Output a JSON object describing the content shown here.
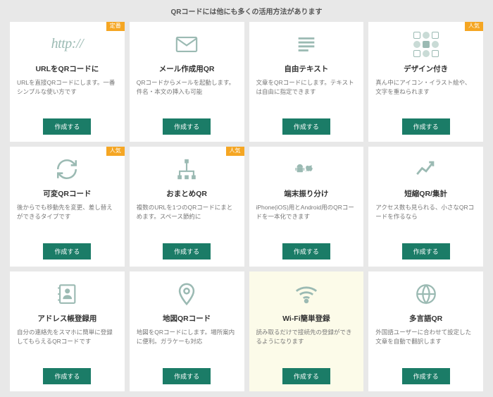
{
  "page_title": "QRコードには他にも多くの活用方法があります",
  "button_label": "作成する",
  "badges": {
    "standard": "定番",
    "popular": "人気"
  },
  "icon_http": "http://",
  "cards": [
    {
      "title": "URLをQRコードに",
      "desc": "URLを直接QRコードにします。一番シンプルな使い方です",
      "badge": "standard"
    },
    {
      "title": "メール作成用QR",
      "desc": "QRコードからメールを起動します。件名・本文の挿入も可能"
    },
    {
      "title": "自由テキスト",
      "desc": "文章をQRコードにします。テキストは自由に指定できます"
    },
    {
      "title": "デザイン付き",
      "desc": "真ん中にアイコン・イラスト絵や、文字を重ねられます",
      "badge": "popular"
    },
    {
      "title": "可変QRコード",
      "desc": "後からでも移動先を変更、差し替えができるタイプです",
      "badge": "popular"
    },
    {
      "title": "おまとめQR",
      "desc": "複数のURLを1つのQRコードにまとめます。スペース節約に",
      "badge": "popular"
    },
    {
      "title": "端末振り分け",
      "desc": "iPhone(iOS)用とAndroid用のQRコードを一本化できます"
    },
    {
      "title": "短縮QR/集計",
      "desc": "アクセス数も見られる、小さなQRコードを作るなら"
    },
    {
      "title": "アドレス帳登録用",
      "desc": "自分の連絡先をスマホに簡単に登録してもらえるQRコードです"
    },
    {
      "title": "地図QRコード",
      "desc": "地図をQRコードにします。場所案内に便利。ガラケーも対応"
    },
    {
      "title": "Wi-Fi簡単登録",
      "desc": "読み取るだけで接続先の登録ができるようになります",
      "highlight": true
    },
    {
      "title": "多言語QR",
      "desc": "外国語ユーザーに合わせて設定した文章を自動で翻訳します"
    }
  ]
}
